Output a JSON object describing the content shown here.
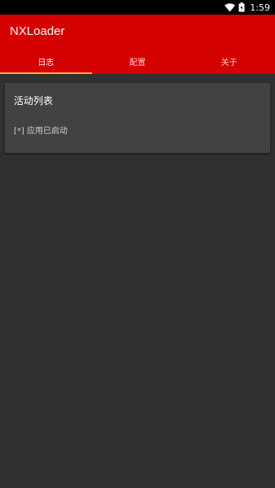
{
  "status_bar": {
    "wifi_icon": "wifi-icon",
    "battery_icon": "battery-charging-icon",
    "time": "1:59"
  },
  "app_bar": {
    "title": "NXLoader",
    "color": "#d50000",
    "tabs": [
      {
        "label": "日志",
        "active": true
      },
      {
        "label": "配置",
        "active": false
      },
      {
        "label": "关于",
        "active": false
      }
    ],
    "indicator_color": "#ffab40"
  },
  "log_card": {
    "title": "活动列表",
    "entries": [
      "[*] 应用已启动"
    ]
  }
}
